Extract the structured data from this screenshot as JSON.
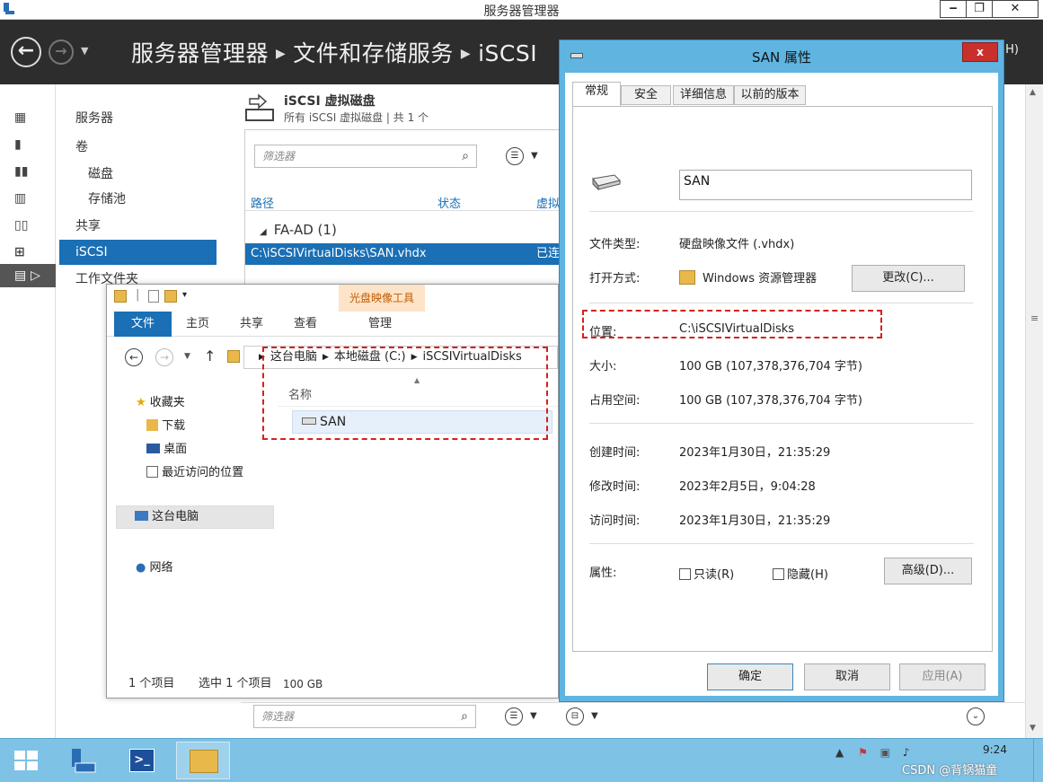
{
  "server_manager": {
    "window_title": "服务器管理器",
    "win_controls": {
      "minimize": "‒",
      "restore": "❐",
      "close": "✕"
    },
    "breadcrumb": [
      "服务器管理器",
      "文件和存储服务",
      "iSCSI"
    ],
    "header_right": "(H)",
    "nav": {
      "items": [
        {
          "label": "服务器"
        },
        {
          "label": "卷"
        },
        {
          "label": "磁盘"
        },
        {
          "label": "存储池"
        },
        {
          "label": "共享"
        },
        {
          "label": "iSCSI"
        },
        {
          "label": "工作文件夹"
        }
      ]
    },
    "iscsi": {
      "title": "iSCSI 虚拟磁盘",
      "subtitle": "所有 iSCSI 虚拟磁盘 | 共 1 个",
      "filter_placeholder": "筛选器",
      "columns": [
        "路径",
        "状态",
        "虚拟"
      ],
      "group": "FA-AD (1)",
      "selected_row": {
        "path": "C:\\iSCSIVirtualDisks\\SAN.vhdx",
        "status": "已连"
      }
    },
    "bottom_filter_placeholder": "筛选器"
  },
  "explorer": {
    "contextual_tab": "光盘映像工具",
    "tabs": [
      "文件",
      "主页",
      "共享",
      "查看",
      "管理"
    ],
    "address": [
      "这台电脑",
      "本地磁盘 (C:)",
      "iSCSIVirtualDisks"
    ],
    "nav_items": {
      "favorites": "收藏夹",
      "downloads": "下载",
      "desktop": "桌面",
      "recent": "最近访问的位置",
      "this_pc": "这台电脑",
      "network": "网络"
    },
    "column_name": "名称",
    "file": "SAN",
    "status": {
      "count": "1 个项目",
      "selected": "选中 1 个项目",
      "size": "100 GB"
    }
  },
  "properties": {
    "title": "SAN 属性",
    "close_label": "x",
    "tabs": [
      "常规",
      "安全",
      "详细信息",
      "以前的版本"
    ],
    "name": "SAN",
    "rows": {
      "file_type": {
        "label": "文件类型:",
        "value": "硬盘映像文件 (.vhdx)"
      },
      "opens_with": {
        "label": "打开方式:",
        "value": "Windows 资源管理器",
        "button": "更改(C)..."
      },
      "location": {
        "label": "位置:",
        "value": "C:\\iSCSIVirtualDisks"
      },
      "size": {
        "label": "大小:",
        "value": "100 GB (107,378,376,704 字节)"
      },
      "size_on_disk": {
        "label": "占用空间:",
        "value": "100 GB (107,378,376,704 字节)"
      },
      "created": {
        "label": "创建时间:",
        "value": "2023年1月30日，21:35:29"
      },
      "modified": {
        "label": "修改时间:",
        "value": "2023年2月5日，9:04:28"
      },
      "accessed": {
        "label": "访问时间:",
        "value": "2023年1月30日，21:35:29"
      },
      "attributes": {
        "label": "属性:",
        "readonly": "只读(R)",
        "hidden": "隐藏(H)",
        "advanced": "高级(D)..."
      }
    },
    "buttons": {
      "ok": "确定",
      "cancel": "取消",
      "apply": "应用(A)"
    }
  },
  "taskbar": {
    "time": "9:24",
    "watermark": "CSDN @背锅猫童"
  },
  "colors": {
    "accent": "#1a6fb5",
    "highlight_dash": "#d62020",
    "taskbar": "#7ec2e6",
    "dialog_frame": "#5fb4e0"
  }
}
